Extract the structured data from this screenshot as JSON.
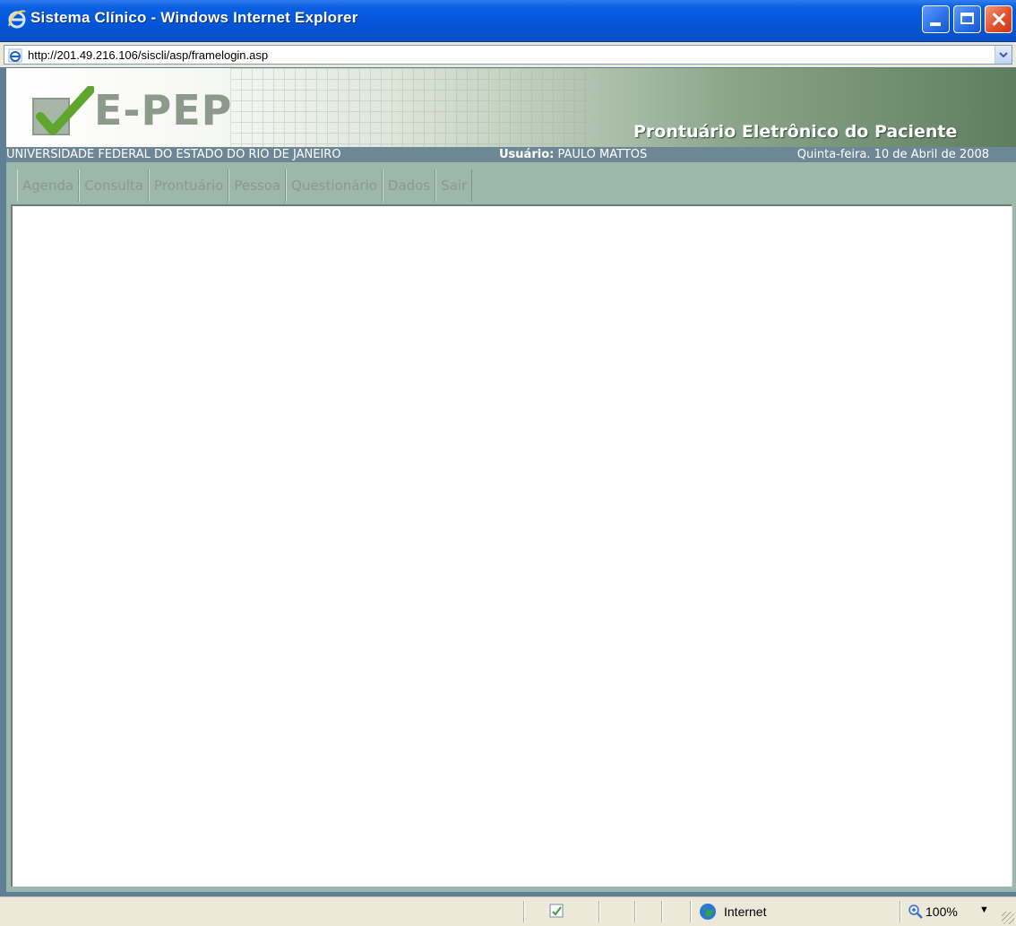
{
  "window": {
    "title": "Sistema Clínico - Windows Internet Explorer"
  },
  "address": {
    "url": "http://201.49.216.106/siscli/asp/framelogin.asp"
  },
  "banner": {
    "logo": "E-PEP",
    "subtitle": "Prontuário Eletrônico do Paciente"
  },
  "infobar": {
    "university": "UNIVERSIDADE FEDERAL DO ESTADO DO RIO DE JANEIRO",
    "user_label": "Usuário:",
    "user_name": "PAULO MATTOS",
    "date": "Quinta-feira. 10 de Abril de 2008"
  },
  "nav": {
    "tabs": [
      {
        "label": "Agenda"
      },
      {
        "label": "Consulta"
      },
      {
        "label": "Prontuário"
      },
      {
        "label": "Pessoa"
      },
      {
        "label": "Questionário"
      },
      {
        "label": "Dados"
      },
      {
        "label": "Sair"
      }
    ]
  },
  "status": {
    "zone": "Internet",
    "zoom": "100%"
  },
  "colors": {
    "page_bg": "#9cb8ac",
    "infobar_bg": "#6e8797",
    "tab_text": "#8a9a8e",
    "titlebar": "#0555d8"
  },
  "icons": {
    "title": "ie-icon",
    "address": "ie-page-icon",
    "security": "security-icon",
    "zone": "globe-icon",
    "zoom": "zoom-icon"
  }
}
